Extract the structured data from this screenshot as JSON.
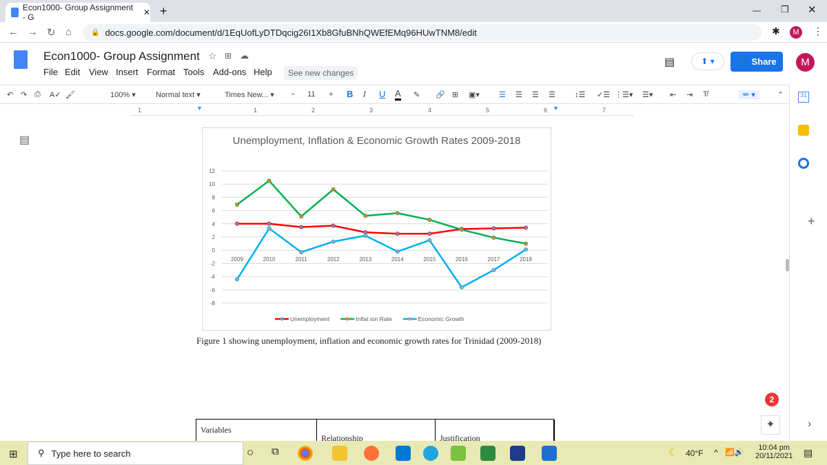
{
  "browser": {
    "tab_title": "Econ1000- Group Assignment - G",
    "url": "docs.google.com/document/d/1EqUofLyDTDqcig26I1Xb8GfuBNhQWEfEMq96HUwTNM8/edit",
    "profile_initial": "M"
  },
  "doc": {
    "title": "Econ1000- Group Assignment",
    "menus": [
      "File",
      "Edit",
      "View",
      "Insert",
      "Format",
      "Tools",
      "Add-ons",
      "Help"
    ],
    "see_new_changes": "See new changes",
    "share_label": "Share",
    "avatar_initial": "M"
  },
  "toolbar": {
    "zoom": "100%",
    "style": "Normal text",
    "font": "Times New...",
    "font_size": "11",
    "bold": "B",
    "italic": "I",
    "underline": "U",
    "text_color": "A"
  },
  "ruler": {
    "marks": [
      "1",
      "1",
      "2",
      "3",
      "4",
      "5",
      "6",
      "7"
    ]
  },
  "chart_data": {
    "type": "line",
    "title": "Unemployment, Inflation & Economic Growth Rates 2009-2018",
    "categories": [
      "2009",
      "2010",
      "2011",
      "2012",
      "2013",
      "2014",
      "2015",
      "2016",
      "2017",
      "2018"
    ],
    "ylim": [
      -8,
      12
    ],
    "yticks": [
      "12",
      "10",
      "8",
      "6",
      "4",
      "2",
      "0",
      "-2",
      "-4",
      "-6",
      "-8"
    ],
    "grid": true,
    "legend": "bottom",
    "series": [
      {
        "name": "Unemployment",
        "color": "#ff0000",
        "marker": "#5b9bd5",
        "values": [
          4.0,
          4.0,
          3.5,
          3.7,
          2.7,
          2.5,
          2.5,
          3.2,
          3.3,
          3.4
        ]
      },
      {
        "name": "Inflat ion Rate",
        "color": "#00b050",
        "marker": "#ed7d31",
        "values": [
          6.9,
          10.5,
          5.1,
          9.2,
          5.2,
          5.6,
          4.6,
          3.1,
          1.9,
          1.0
        ]
      },
      {
        "name": "Economic Growth",
        "color": "#00b0f0",
        "marker": "#a5a5a5",
        "values": [
          -4.4,
          3.3,
          -0.3,
          1.3,
          2.2,
          -0.2,
          1.5,
          -5.6,
          -3.0,
          0.1
        ]
      }
    ]
  },
  "caption": "Figure 1 showing unemployment, inflation and economic growth rates for Trinidad (2009-2018)",
  "table": {
    "headers": [
      "Variables",
      "Relationship",
      "Justification"
    ]
  },
  "side": {
    "badge": "2"
  },
  "taskbar": {
    "search_placeholder": "Type here to search",
    "weather": "40°F",
    "time": "10:04 pm",
    "date": "20/11/2021"
  }
}
